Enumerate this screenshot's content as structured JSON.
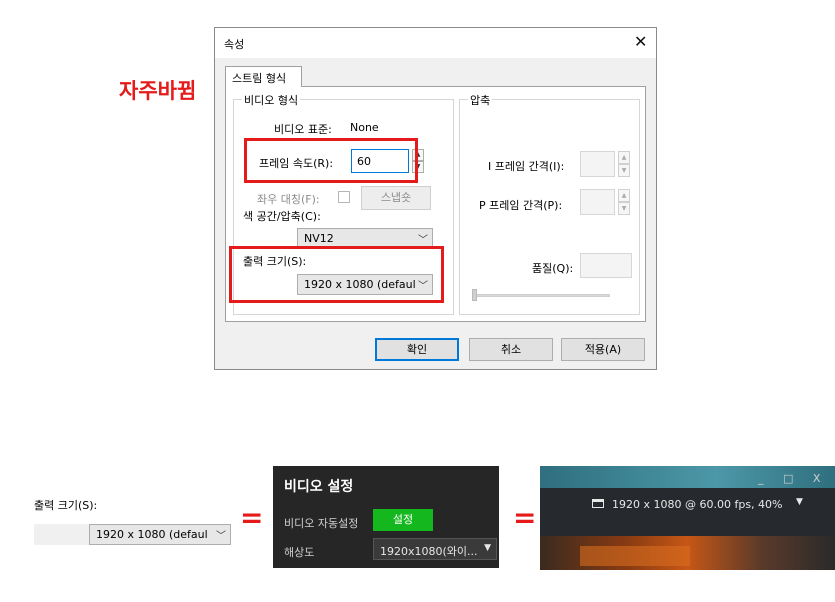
{
  "dialog": {
    "title": "속성",
    "close_glyph": "✕",
    "tab_label": "스트림 형식",
    "video_group": {
      "title": "비디오 형식",
      "standard_label": "비디오 표준:",
      "standard_value": "None",
      "framerate_label": "프레임 속도(R):",
      "framerate_value": "60",
      "flip_label": "좌우 대칭(F):",
      "snapshot_label": "스냅숏",
      "colorspace_label": "색 공간/압축(C):",
      "colorspace_value": "NV12",
      "output_label": "출력 크기(S):",
      "output_value": "1920 x 1080  (defaul"
    },
    "compress_group": {
      "title": "압축",
      "iframe_label": "I 프레임 간격(I):",
      "pframe_label": "P 프레임 간격(P):",
      "quality_label": "품질(Q):"
    },
    "buttons": {
      "ok": "확인",
      "cancel": "취소",
      "apply": "적용(A)"
    }
  },
  "annotation": {
    "note": "자주바뀜",
    "equals": "="
  },
  "crop_output": {
    "label": "출력 크기(S):",
    "value": "1920 x 1080  (defaul"
  },
  "video_settings_panel": {
    "title": "비디오 설정",
    "auto_label": "비디오 자동설정",
    "auto_button": "설정",
    "resolution_label": "해상도",
    "resolution_value": "1920x1080(와이..."
  },
  "stream_overlay": {
    "window_controls": "_ □ X",
    "info_text": "1920 x 1080 @ 60.00 fps, 40%",
    "dropdown_glyph": "▼"
  }
}
